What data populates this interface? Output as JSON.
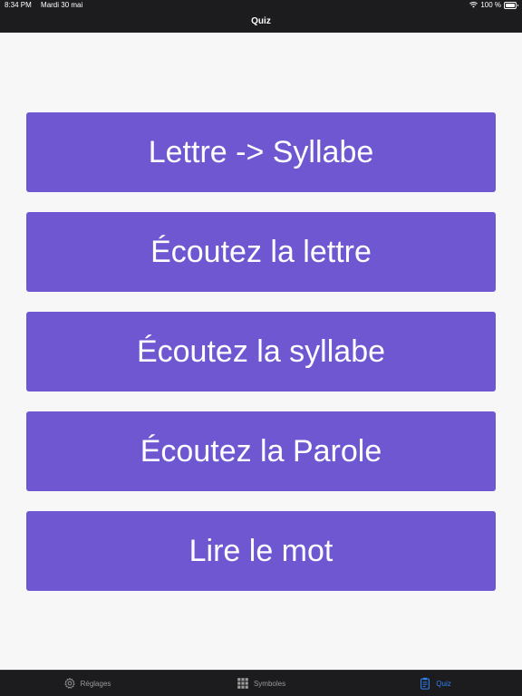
{
  "status_bar": {
    "time": "8:34 PM",
    "date": "Mardi 30 mai",
    "battery": "100 %"
  },
  "nav": {
    "title": "Quiz"
  },
  "quiz_buttons": [
    {
      "label": "Lettre -> Syllabe"
    },
    {
      "label": "Écoutez la lettre"
    },
    {
      "label": "Écoutez la syllabe"
    },
    {
      "label": "Écoutez la Parole"
    },
    {
      "label": "Lire le mot"
    }
  ],
  "colors": {
    "button": "#6e57d0",
    "bar": "#1c1c1e",
    "active_tab": "#2f82f5",
    "background": "#f7f7f7"
  },
  "tabs": [
    {
      "label": "Réglages",
      "icon": "gear-icon",
      "active": false
    },
    {
      "label": "Symboles",
      "icon": "grid-icon",
      "active": false
    },
    {
      "label": "Quiz",
      "icon": "clipboard-icon",
      "active": true
    }
  ]
}
